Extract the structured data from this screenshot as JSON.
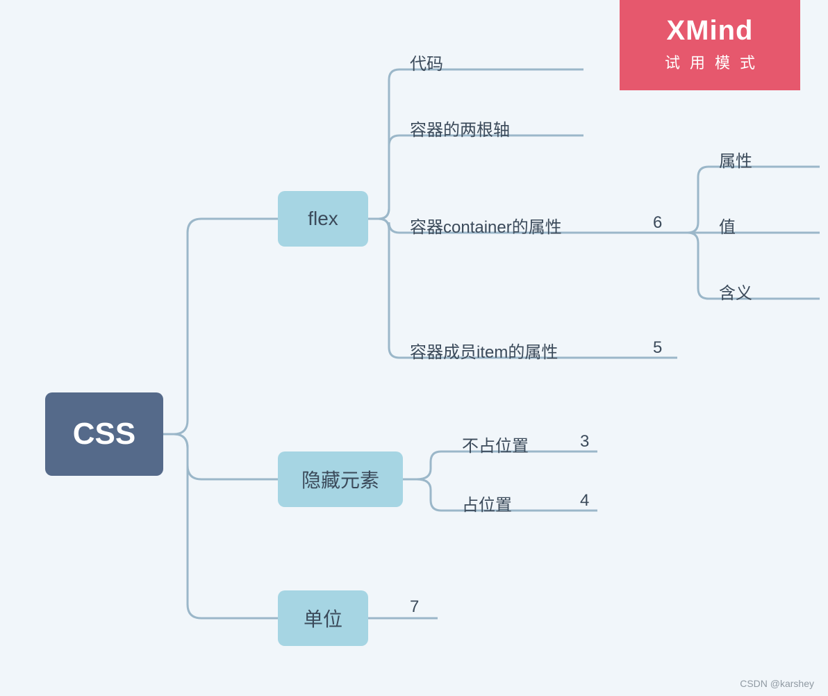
{
  "watermark": {
    "brand": "XMind",
    "mode": "试用模式"
  },
  "credit": "CSDN @karshey",
  "root": {
    "label": "CSS"
  },
  "topics": {
    "flex": {
      "label": "flex"
    },
    "hide": {
      "label": "隐藏元素"
    },
    "unit": {
      "label": "单位",
      "count": "7"
    }
  },
  "flex_children": {
    "code": {
      "label": "代码"
    },
    "axes": {
      "label": "容器的两根轴"
    },
    "container": {
      "label": "容器container的属性",
      "count": "6"
    },
    "item": {
      "label": "容器成员item的属性",
      "count": "5"
    }
  },
  "container_children": {
    "attr": {
      "label": "属性"
    },
    "value": {
      "label": "值"
    },
    "meaning": {
      "label": "含义"
    }
  },
  "hide_children": {
    "no_occupy": {
      "label": "不占位置",
      "count": "3"
    },
    "occupy": {
      "label": "占位置",
      "count": "4"
    }
  }
}
